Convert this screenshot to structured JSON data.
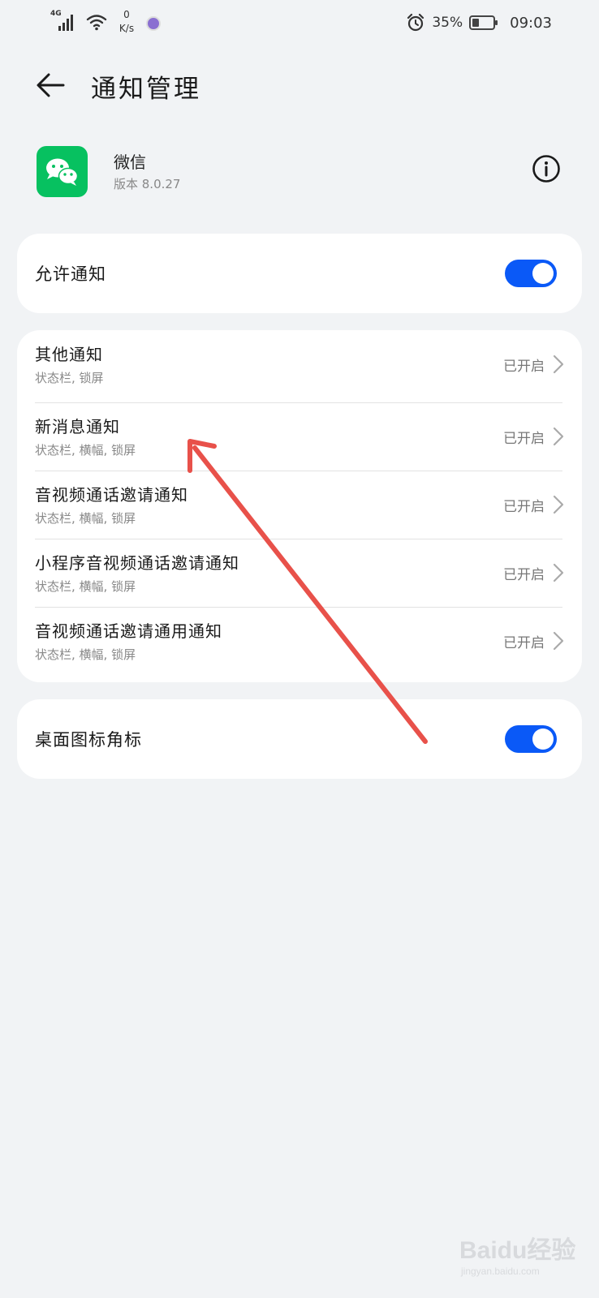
{
  "status_bar": {
    "signal_label": "4G",
    "net_speed_value": "0",
    "net_speed_unit": "K/s",
    "battery_percent": "35%",
    "battery_level": 0.35,
    "time": "09:03"
  },
  "header": {
    "title": "通知管理",
    "back_icon": "back-arrow-icon"
  },
  "app": {
    "name": "微信",
    "version": "版本 8.0.27",
    "icon": "wechat-icon",
    "icon_color": "#07c160",
    "info_icon": "info-icon"
  },
  "allow_notifications": {
    "label": "允许通知",
    "enabled": true
  },
  "channels": [
    {
      "title": "其他通知",
      "subtitle": "状态栏, 锁屏",
      "status": "已开启"
    },
    {
      "title": "新消息通知",
      "subtitle": "状态栏, 横幅, 锁屏",
      "status": "已开启"
    },
    {
      "title": "音视频通话邀请通知",
      "subtitle": "状态栏, 横幅, 锁屏",
      "status": "已开启"
    },
    {
      "title": "小程序音视频通话邀请通知",
      "subtitle": "状态栏, 横幅, 锁屏",
      "status": "已开启"
    },
    {
      "title": "音视频通话邀请通用通知",
      "subtitle": "状态栏, 横幅, 锁屏",
      "status": "已开启"
    }
  ],
  "badge": {
    "label": "桌面图标角标",
    "enabled": true
  },
  "colors": {
    "background": "#f1f3f5",
    "toggle_on": "#0a59f7",
    "annotation_arrow": "#e8514a"
  },
  "watermark": {
    "text": "Baidu经验",
    "sub": "jingyan.baidu.com"
  }
}
